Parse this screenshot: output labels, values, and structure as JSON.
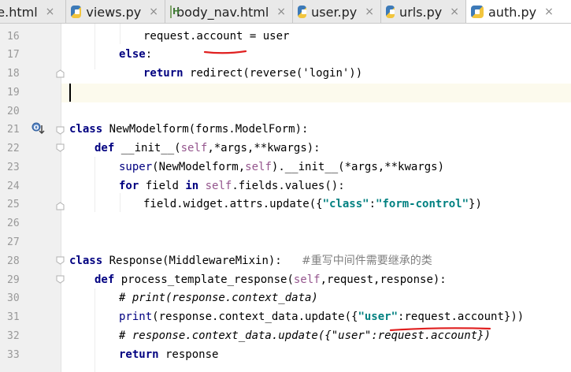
{
  "tabs": [
    {
      "label": "te.html",
      "icon": "html-file-icon",
      "active": false
    },
    {
      "label": "views.py",
      "icon": "python-file-icon",
      "active": false
    },
    {
      "label": "body_nav.html",
      "icon": "html-file-icon",
      "active": false
    },
    {
      "label": "user.py",
      "icon": "python-file-icon",
      "active": false
    },
    {
      "label": "urls.py",
      "icon": "python-file-icon",
      "active": false
    },
    {
      "label": "auth.py",
      "icon": "python-file-icon",
      "active": true
    }
  ],
  "tab_close_glyph": "×",
  "html_icon_letter": "H",
  "editor": {
    "current_line": 19,
    "lines": [
      {
        "n": "16"
      },
      {
        "n": "17"
      },
      {
        "n": "18"
      },
      {
        "n": "19"
      },
      {
        "n": "20"
      },
      {
        "n": "21"
      },
      {
        "n": "22"
      },
      {
        "n": "23"
      },
      {
        "n": "24"
      },
      {
        "n": "25"
      },
      {
        "n": "26"
      },
      {
        "n": "27"
      },
      {
        "n": "28"
      },
      {
        "n": "29"
      },
      {
        "n": "30"
      },
      {
        "n": "31"
      },
      {
        "n": "32"
      },
      {
        "n": "33"
      }
    ],
    "code": {
      "l16": "request.account = user",
      "l17_kw": "else",
      "l17_rest": ":",
      "l18_kw": "return",
      "l18_rest": " redirect(reverse('login'))",
      "l21_kw": "class",
      "l21_rest": " NewModelform(forms.ModelForm):",
      "l22_kw": "def",
      "l22_name": " __init__(",
      "l22_self": "self",
      "l22_rest": ",*args,**kwargs):",
      "l23_bi": "super",
      "l23_a": "(NewModelform,",
      "l23_self": "self",
      "l23_b": ").__init__(*args,**kwargs)",
      "l24_kw1": "for",
      "l24_a": " field ",
      "l24_kw2": "in",
      "l24_self": " self",
      "l24_b": ".fields.values():",
      "l25_a": "field.widget.attrs.update({",
      "l25_s1": "\"class\"",
      "l25_b": ":",
      "l25_s2": "\"form-control\"",
      "l25_c": "})",
      "l28_kw": "class",
      "l28_rest": " Response(MiddlewareMixin):   ",
      "l28_comment": "#重写中间件需要继承的类",
      "l29_kw": "def",
      "l29_name": " process_template_response(",
      "l29_self": "self",
      "l29_rest": ",request,response):",
      "l30_comment": "# print(response.context_data)",
      "l31_bi": "print",
      "l31_a": "(response.context_data.update({",
      "l31_s": "\"user\"",
      "l31_b": ":request.account}))",
      "l32_comment": "# response.context_data.update({\"user\":request.account})",
      "l33_kw": "return",
      "l33_rest": " response"
    }
  },
  "colors": {
    "keyword": "#000080",
    "self": "#94558d",
    "string": "#008080",
    "comment": "#808080",
    "annotation_red": "#e02020",
    "gutter_bg": "#f0f0f0",
    "current_line_bg": "#fcfaed"
  },
  "gutter_icons": [
    "override-icon",
    "fold-marker-icon"
  ]
}
